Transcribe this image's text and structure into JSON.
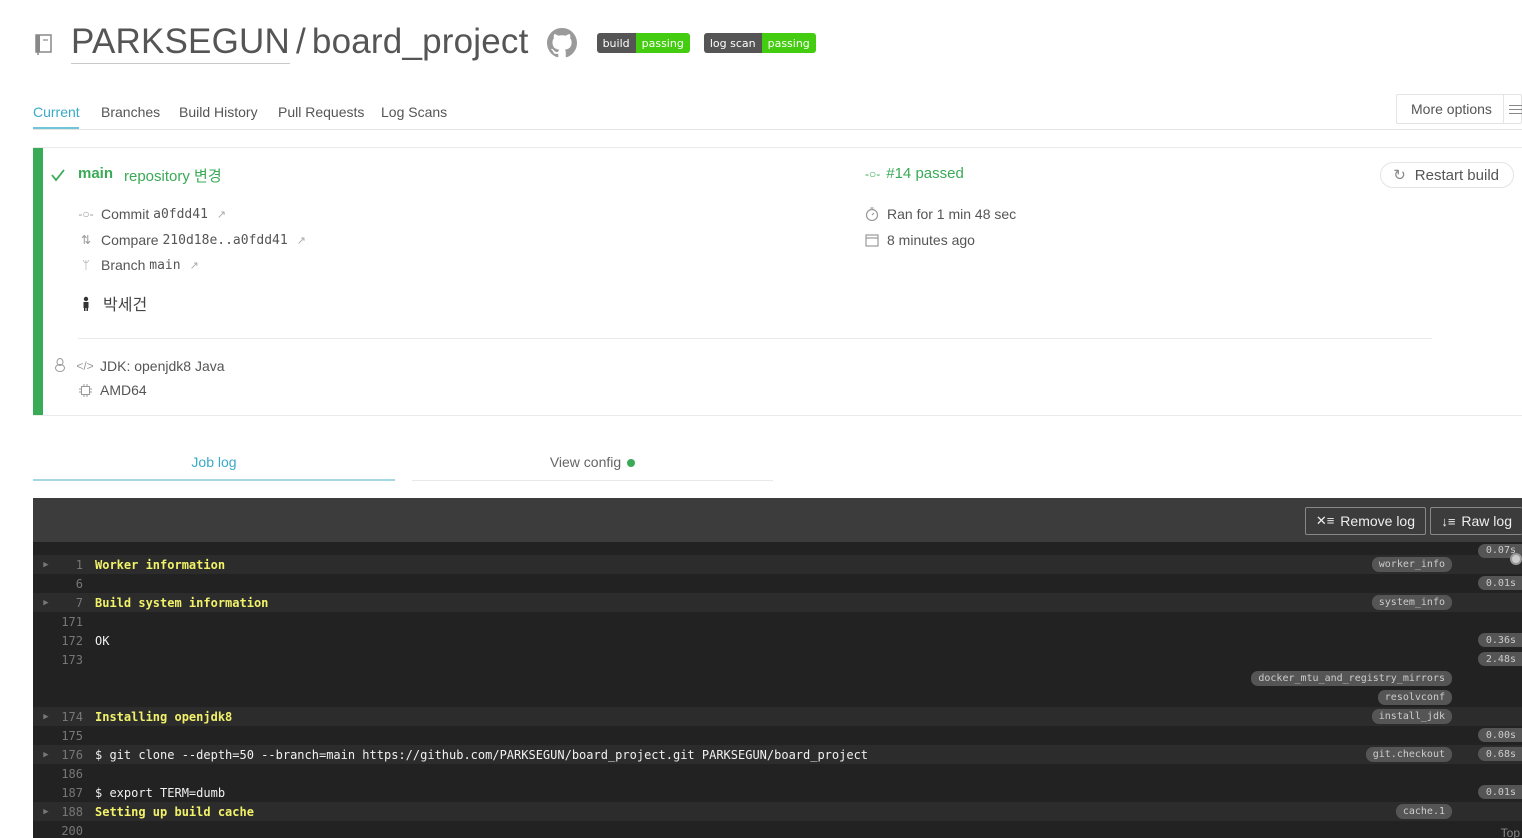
{
  "repo": {
    "owner": "PARKSEGUN",
    "separator": "/",
    "name": "board_project",
    "badges": [
      {
        "left": "build",
        "right": "passing"
      },
      {
        "left": "log scan",
        "right": "passing"
      }
    ]
  },
  "tabs": [
    "Current",
    "Branches",
    "Build History",
    "Pull Requests",
    "Log Scans"
  ],
  "more_options": "More options",
  "build": {
    "branch": "main",
    "message": "repository 변경",
    "commit_label": "Commit",
    "commit_sha": "a0fdd41",
    "compare_label": "Compare",
    "compare_range": "210d18e..a0fdd41",
    "branch_label": "Branch",
    "branch_value": "main",
    "author": "박세건",
    "status": "#14 passed",
    "duration": "Ran for 1 min 48 sec",
    "finished": "8 minutes ago",
    "restart": "Restart build",
    "jdk": "JDK: openjdk8 Java",
    "arch": "AMD64",
    "colors": {
      "passed": "#39aa56",
      "accent": "#3aa9c9"
    }
  },
  "job_tabs": {
    "log": "Job log",
    "config": "View config"
  },
  "log": {
    "remove": "Remove log",
    "raw": "Raw log",
    "top": "Top",
    "lines": [
      {
        "num": "1",
        "text": "Worker information",
        "fold": true,
        "tag": "worker_info"
      },
      {
        "num": "6",
        "text": "",
        "fold": false
      },
      {
        "num": "7",
        "text": "Build system information",
        "fold": true,
        "tag": "system_info"
      },
      {
        "num": "171",
        "text": "",
        "fold": false
      },
      {
        "num": "172",
        "text": "OK",
        "fold": false
      },
      {
        "num": "173",
        "text": "",
        "fold": false
      },
      {
        "num": "",
        "text": "",
        "fold": false,
        "tag": "docker_mtu_and_registry_mirrors"
      },
      {
        "num": "",
        "text": "",
        "fold": false,
        "tag": "resolvconf"
      },
      {
        "num": "174",
        "text": "Installing openjdk8",
        "fold": true,
        "tag": "install_jdk"
      },
      {
        "num": "175",
        "text": "",
        "fold": false
      },
      {
        "num": "176",
        "text": "$ git clone --depth=50 --branch=main https://github.com/PARKSEGUN/board_project.git PARKSEGUN/board_project",
        "fold": true,
        "tag": "git.checkout"
      },
      {
        "num": "186",
        "text": "",
        "fold": false
      },
      {
        "num": "187",
        "text": "$ export TERM=dumb",
        "fold": false
      },
      {
        "num": "188",
        "text": "Setting up build cache",
        "fold": true,
        "tag": "cache.1"
      },
      {
        "num": "200",
        "text": "",
        "fold": false
      }
    ],
    "times": [
      "0.07s",
      "0.01s",
      "0.36s",
      "2.48s",
      "0.00s",
      "0.68s",
      "0.01s"
    ]
  }
}
